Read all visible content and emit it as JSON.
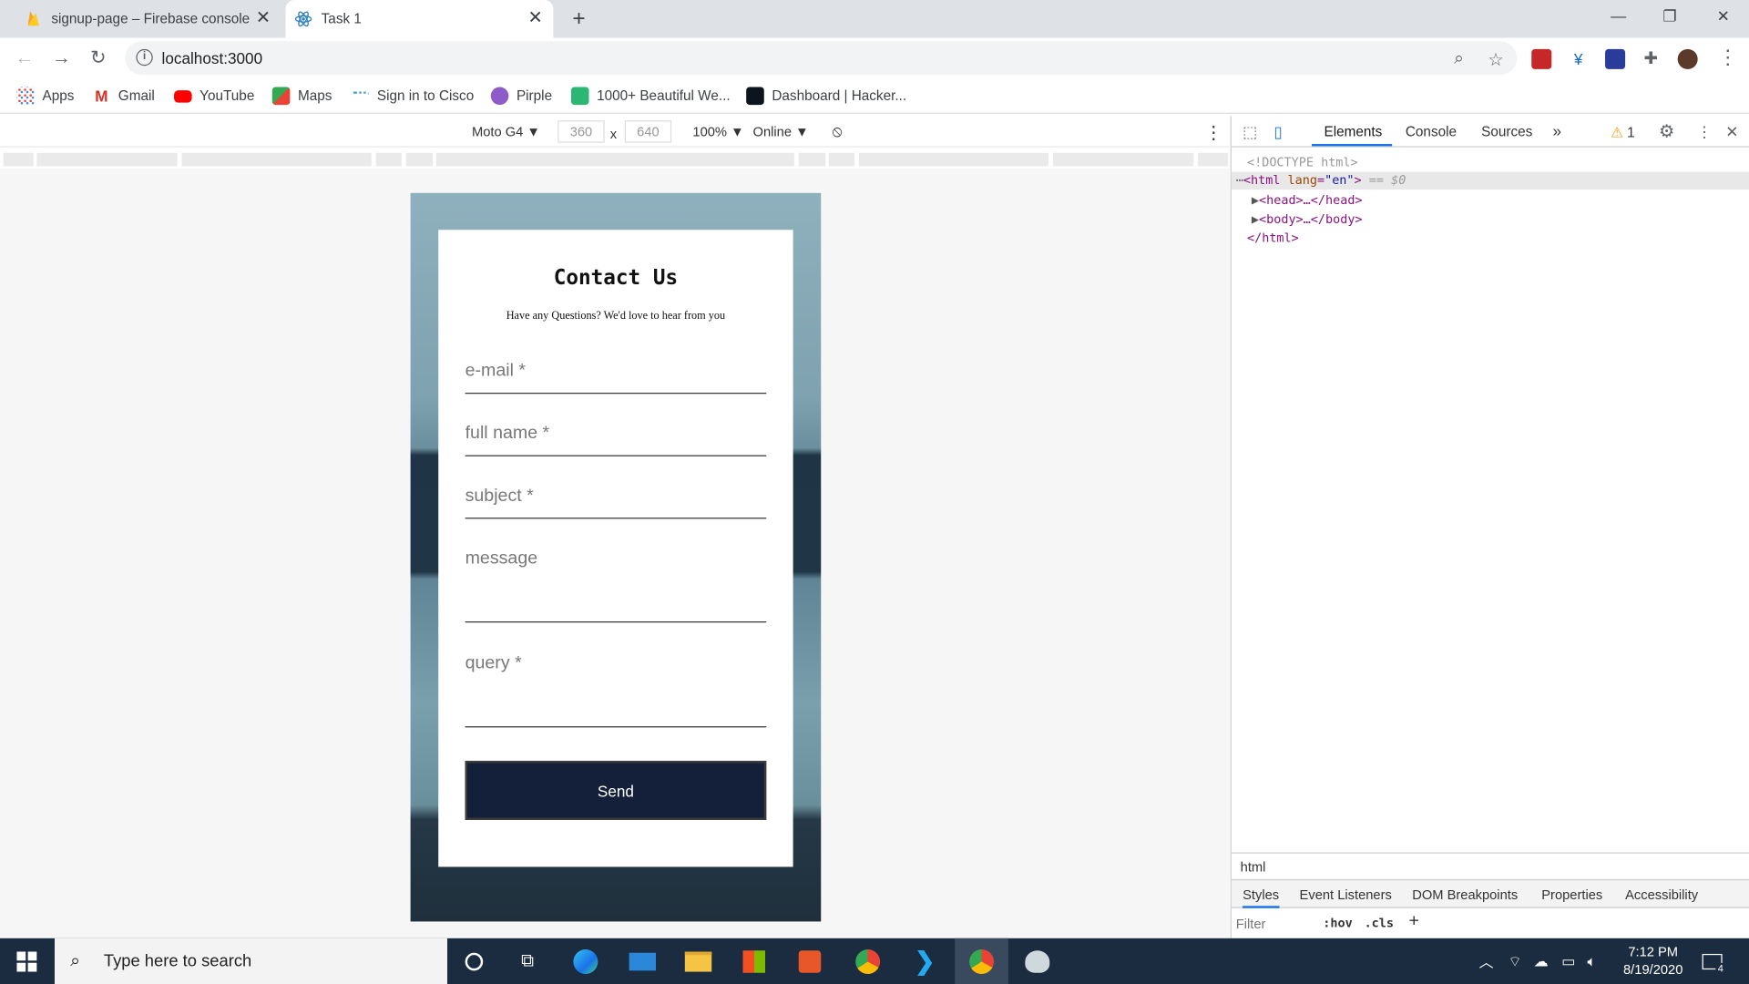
{
  "browser": {
    "tabs": [
      {
        "title": "signup-page – Firebase console",
        "icon": "firebase-icon"
      },
      {
        "title": "Task 1",
        "icon": "react-icon",
        "active": true
      }
    ],
    "new_tab": "+",
    "url": "localhost:3000",
    "bookmarks": [
      {
        "label": "Apps",
        "icon": "apps-grid-icon"
      },
      {
        "label": "Gmail",
        "icon": "gmail-icon"
      },
      {
        "label": "YouTube",
        "icon": "youtube-icon"
      },
      {
        "label": "Maps",
        "icon": "maps-icon"
      },
      {
        "label": "Sign in to Cisco",
        "icon": "cisco-icon"
      },
      {
        "label": "Pirple",
        "icon": "pirple-icon"
      },
      {
        "label": "1000+ Beautiful We...",
        "icon": "bookmark-page-icon"
      },
      {
        "label": "Dashboard | Hacker...",
        "icon": "hackerrank-icon"
      }
    ]
  },
  "device_toolbar": {
    "device": "Moto G4",
    "width": "360",
    "height": "640",
    "times": "x",
    "zoom": "100%",
    "network": "Online"
  },
  "contact_form": {
    "title": "Contact Us",
    "subtitle": "Have any Questions? We'd love to hear from you",
    "email_placeholder": "e-mail *",
    "fullname_placeholder": "full name *",
    "subject_placeholder": "subject *",
    "message_placeholder": "message",
    "query_placeholder": "query *",
    "send_label": "Send"
  },
  "devtools": {
    "tabs": [
      "Elements",
      "Console",
      "Sources"
    ],
    "more": "»",
    "warning_count": "1",
    "dom": {
      "doctype": "<!DOCTYPE html>",
      "html_open_tag": "html",
      "lang_attr": "lang",
      "lang_val": "\"en\"",
      "selected_marker": "== $0",
      "head": "<head>…</head>",
      "body": "<body>…</body>",
      "html_close": "</html>"
    },
    "breadcrumb": "html",
    "subtabs": [
      "Styles",
      "Event Listeners",
      "DOM Breakpoints",
      "Properties",
      "Accessibility"
    ],
    "filter_placeholder": "Filter",
    "hov": ":hov",
    "cls": ".cls",
    "add": "+"
  },
  "taskbar": {
    "search_placeholder": "Type here to search",
    "time": "7:12 PM",
    "date": "8/19/2020",
    "notification_count": "4"
  }
}
